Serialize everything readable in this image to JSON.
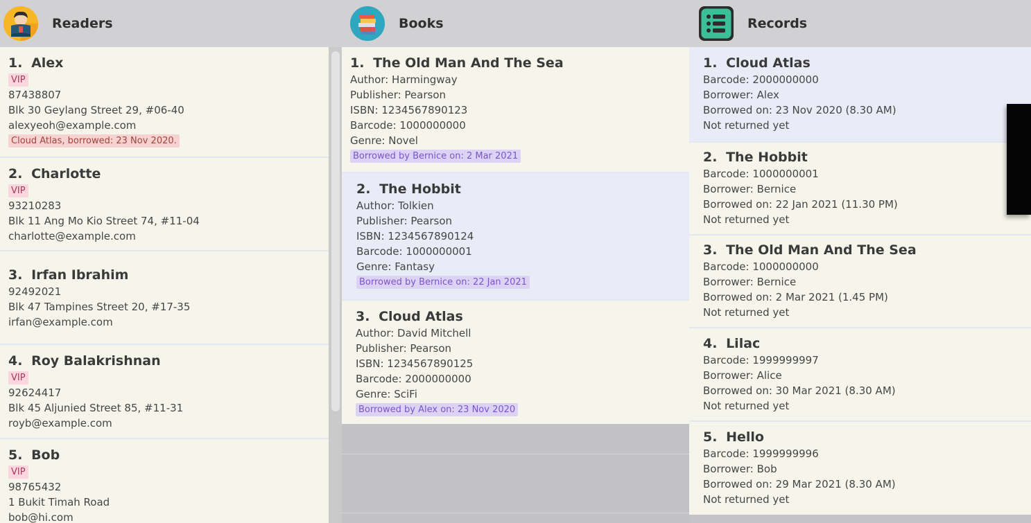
{
  "header": {
    "readers_title": "Readers",
    "books_title": "Books",
    "records_title": "Records"
  },
  "icons": {
    "readers": "reader-avatar-icon",
    "books": "books-stack-icon",
    "records": "list-icon"
  },
  "colors": {
    "vip_bg": "#fbd6e0",
    "vip_text": "#a63b57",
    "borrow_bg": "#f6d2d0",
    "book_tag_bg": "#dcd2f4",
    "book_tag_text": "#7a54cc",
    "card_bg": "#f6f5ec",
    "card_selected_bg": "#e9ebf6"
  },
  "readers": [
    {
      "idx": "1.",
      "name": "Alex",
      "vip": "VIP",
      "phone": "87438807",
      "address": "Blk 30 Geylang Street 29, #06-40",
      "email": "alexyeoh@example.com",
      "borrowed": "Cloud Atlas, borrowed: 23 Nov 2020."
    },
    {
      "idx": "2.",
      "name": "Charlotte",
      "vip": "VIP",
      "phone": "93210283",
      "address": "Blk 11 Ang Mo Kio Street 74, #11-04",
      "email": "charlotte@example.com"
    },
    {
      "idx": "3.",
      "name": "Irfan Ibrahim",
      "phone": "92492021",
      "address": "Blk 47 Tampines Street 20, #17-35",
      "email": "irfan@example.com"
    },
    {
      "idx": "4.",
      "name": "Roy Balakrishnan",
      "vip": "VIP",
      "phone": "92624417",
      "address": "Blk 45 Aljunied Street 85, #11-31",
      "email": "royb@example.com"
    },
    {
      "idx": "5.",
      "name": "Bob",
      "vip": "VIP",
      "phone": "98765432",
      "address": "1 Bukit Timah Road",
      "email": "bob@hi.com"
    }
  ],
  "books": [
    {
      "idx": "1.",
      "title": "The Old Man And The Sea",
      "author": "Author: Harmingway",
      "publisher": "Publisher: Pearson",
      "isbn": "ISBN: 1234567890123",
      "barcode": "Barcode: 1000000000",
      "genre": "Genre: Novel",
      "borrowed": "Borrowed by Bernice on: 2 Mar 2021"
    },
    {
      "idx": "2.",
      "title": "The Hobbit",
      "author": "Author: Tolkien",
      "publisher": "Publisher: Pearson",
      "isbn": "ISBN: 1234567890124",
      "barcode": "Barcode: 1000000001",
      "genre": "Genre: Fantasy",
      "borrowed": "Borrowed by Bernice on: 22 Jan 2021"
    },
    {
      "idx": "3.",
      "title": "Cloud Atlas",
      "author": "Author: David Mitchell",
      "publisher": "Publisher: Pearson",
      "isbn": "ISBN: 1234567890125",
      "barcode": "Barcode: 2000000000",
      "genre": "Genre: SciFi",
      "borrowed": "Borrowed by Alex on: 23 Nov 2020"
    }
  ],
  "records": [
    {
      "idx": "1.",
      "title": "Cloud Atlas",
      "barcode": "Barcode: 2000000000",
      "borrower": "Borrower: Alex",
      "borrowed_on": "Borrowed on: 23 Nov 2020 (8.30 AM)",
      "status": "Not returned yet"
    },
    {
      "idx": "2.",
      "title": "The Hobbit",
      "barcode": "Barcode: 1000000001",
      "borrower": "Borrower: Bernice",
      "borrowed_on": "Borrowed on: 22 Jan 2021 (11.30 PM)",
      "status": "Not returned yet"
    },
    {
      "idx": "3.",
      "title": "The Old Man And The Sea",
      "barcode": "Barcode: 1000000000",
      "borrower": "Borrower: Bernice",
      "borrowed_on": "Borrowed on: 2 Mar 2021 (1.45 PM)",
      "status": "Not returned yet"
    },
    {
      "idx": "4.",
      "title": "Lilac",
      "barcode": "Barcode: 1999999997",
      "borrower": "Borrower: Alice",
      "borrowed_on": "Borrowed on: 30 Mar 2021 (8.30 AM)",
      "status": "Not returned yet"
    },
    {
      "idx": "5.",
      "title": "Hello",
      "barcode": "Barcode: 1999999996",
      "borrower": "Borrower: Bob",
      "borrowed_on": "Borrowed on: 29 Mar 2021 (8.30 AM)",
      "status": "Not returned yet"
    }
  ]
}
